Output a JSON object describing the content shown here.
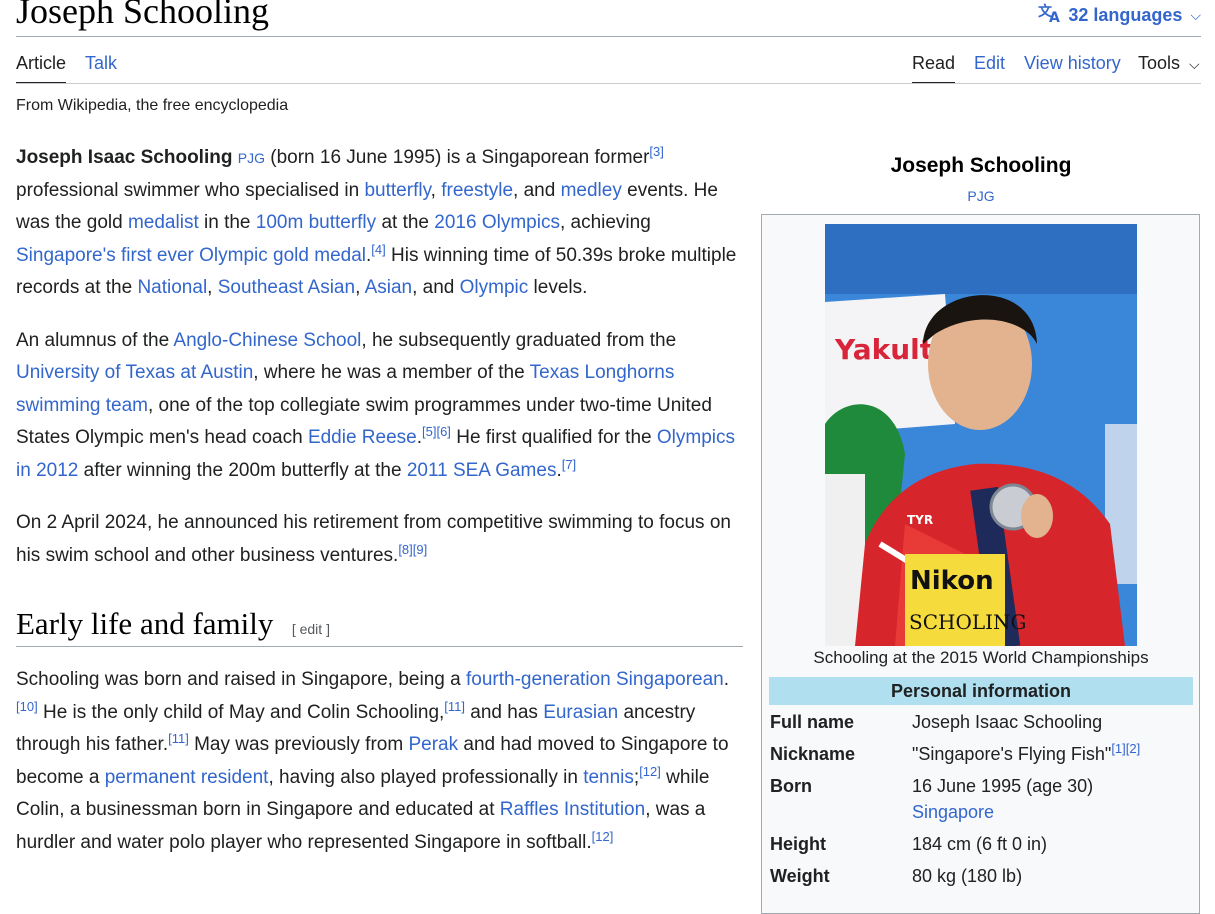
{
  "page": {
    "title": "Joseph Schooling",
    "languages": "32 languages",
    "tagline": "From Wikipedia, the free encyclopedia"
  },
  "tabs": {
    "article": "Article",
    "talk": "Talk",
    "read": "Read",
    "edit": "Edit",
    "view_history": "View history",
    "tools": "Tools"
  },
  "intro": {
    "p1": {
      "name": "Joseph Isaac Schooling",
      "pjg": "PJG",
      "t1": " (born 16 June 1995) is a Singaporean former",
      "ref3": "[3]",
      "t2": " professional swimmer who specialised in ",
      "butterfly": "butterfly",
      "t3": ", ",
      "freestyle": "freestyle",
      "t4": ", and ",
      "medley": "medley",
      "t5": " events. He was the gold ",
      "medalist": "medalist",
      "t6": " in the ",
      "l100m": "100m butterfly",
      "t7": " at the ",
      "olympics2016": "2016 Olympics",
      "t8": ", achieving ",
      "first_gold": "Singapore's first ever Olympic gold medal",
      "t9": ".",
      "ref4": "[4]",
      "t10": " His winning time of 50.39s broke multiple records at the ",
      "national": "National",
      "t11": ", ",
      "sea": "Southeast Asian",
      "t12": ", ",
      "asian": "Asian",
      "t13": ", and ",
      "olympic": "Olympic",
      "t14": " levels."
    },
    "p2": {
      "t1": "An alumnus of the ",
      "acs": "Anglo-Chinese School",
      "t2": ", he subsequently graduated from the ",
      "ut": "University of Texas at Austin",
      "t3": ", where he was a member of the ",
      "longhorns": "Texas Longhorns swimming team",
      "t4": ", one of the top collegiate swim programmes under two-time United States Olympic men's head coach ",
      "reese": "Eddie Reese",
      "t5": ".",
      "ref56": "[5][6]",
      "t6": " He first qualified for the ",
      "oly2012": "Olympics in 2012",
      "t7": " after winning the 200m butterfly at the ",
      "seagames": "2011 SEA Games",
      "t8": ".",
      "ref7": "[7]"
    },
    "p3": {
      "t1": "On 2 April 2024, he announced his retirement from competitive swimming to focus on his swim school and other business ventures.",
      "ref89": "[8][9]"
    }
  },
  "section": {
    "heading": "Early life and family",
    "edit": "[ edit ]",
    "p1": {
      "t1": "Schooling was born and raised in Singapore, being a ",
      "fourth": "fourth-generation Singaporean",
      "t2": ".",
      "ref10": "[10]",
      "t3": " He is the only child of May and Colin Schooling,",
      "ref11a": "[11]",
      "t4": " and has ",
      "eurasian": "Eurasian",
      "t5": " ancestry through his father.",
      "ref11b": "[11]",
      "t6": " May was previously from ",
      "perak": "Perak",
      "t7": " and had moved to Singapore to become a ",
      "pr": "permanent resident",
      "t8": ", having also played professionally in ",
      "tennis": "tennis",
      "t9": ";",
      "ref12a": "[12]",
      "t10": " while Colin, a businessman born in Singapore and educated at ",
      "raffles": "Raffles Institution",
      "t11": ", was a hurdler and water polo player who represented Singapore in softball.",
      "ref12b": "[12]"
    }
  },
  "infobox": {
    "name": "Joseph Schooling",
    "pjg": "PJG",
    "caption": "Schooling at the 2015 World Championships",
    "header": "Personal information",
    "rows": [
      {
        "label": "Full name",
        "value": "Joseph Isaac Schooling"
      },
      {
        "label": "Nickname",
        "value": "\"Singapore's Flying Fish\"",
        "refs": "[1][2]"
      },
      {
        "label": "Born",
        "value": "16 June 1995 (age 30)",
        "link": "Singapore"
      },
      {
        "label": "Height",
        "value": "184 cm (6 ft 0 in)"
      },
      {
        "label": "Weight",
        "value": "80 kg (180 lb)"
      }
    ],
    "photo_text": {
      "yakult": "Yakult",
      "nikon": "Nikon",
      "bib": "SCHOLING",
      "tyr": "TYR"
    }
  },
  "colors": {
    "link": "#3366cc",
    "infobox_header": "#b0e0f0",
    "infobox_bg": "#f8f9fa"
  }
}
